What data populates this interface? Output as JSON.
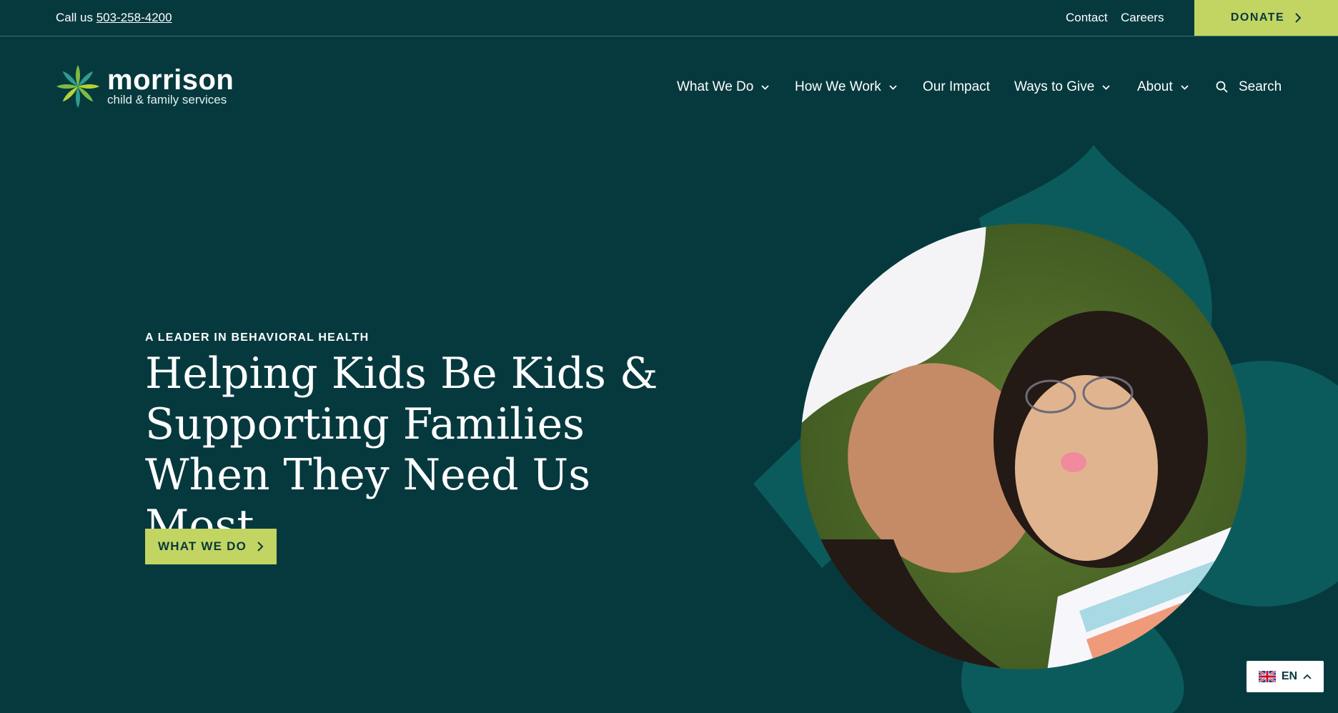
{
  "topbar": {
    "call_prefix": "Call us",
    "phone": "503-258-4200",
    "contact": "Contact",
    "careers": "Careers",
    "donate": "DONATE"
  },
  "logo": {
    "brand": "morrison",
    "tagline": "child & family services"
  },
  "nav": {
    "items": [
      {
        "label": "What We Do",
        "has_dropdown": true
      },
      {
        "label": "How We Work",
        "has_dropdown": true
      },
      {
        "label": "Our Impact",
        "has_dropdown": false
      },
      {
        "label": "Ways to Give",
        "has_dropdown": true
      },
      {
        "label": "About",
        "has_dropdown": true
      }
    ],
    "search": "Search"
  },
  "hero": {
    "eyebrow": "A LEADER IN BEHAVIORAL HEALTH",
    "headline_line1": "Helping Kids Be Kids &",
    "headline_line2": "Supporting Families",
    "headline_line3": "When They Need Us Most",
    "cta": "WHAT WE DO"
  },
  "language": {
    "code": "EN"
  },
  "icons": {
    "search": "search-icon",
    "chevron": "chevron-down-icon",
    "arrow": "chevron-right-icon",
    "flag": "uk-flag-icon"
  },
  "colors": {
    "background": "#06393e",
    "accent": "#c2d462",
    "shape": "#0c5b5c",
    "text": "#ffffff"
  }
}
